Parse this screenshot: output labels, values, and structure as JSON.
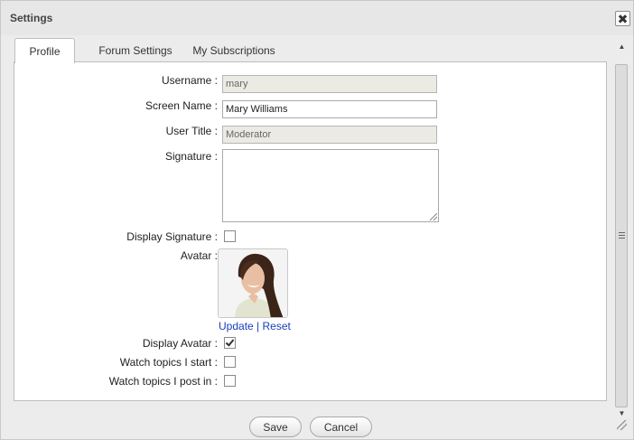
{
  "dialog": {
    "title": "Settings",
    "close_icon": "close-icon"
  },
  "tabs": [
    {
      "label": "Profile",
      "active": true
    },
    {
      "label": "Forum Settings",
      "active": false
    },
    {
      "label": "My Subscriptions",
      "active": false
    }
  ],
  "profile": {
    "username": {
      "label": "Username :",
      "value": "mary",
      "readonly": true
    },
    "screen_name": {
      "label": "Screen Name :",
      "value": "Mary Williams"
    },
    "user_title": {
      "label": "User Title :",
      "value": "Moderator",
      "readonly": true
    },
    "signature": {
      "label": "Signature :",
      "value": ""
    },
    "display_signature": {
      "label": "Display Signature :",
      "checked": false
    },
    "avatar": {
      "label": "Avatar :",
      "update_link": "Update",
      "separator": "|",
      "reset_link": "Reset"
    },
    "display_avatar": {
      "label": "Display Avatar :",
      "checked": true
    },
    "watch_start": {
      "label": "Watch topics I start :",
      "checked": false
    },
    "watch_post": {
      "label": "Watch topics I post in :",
      "checked": false
    }
  },
  "footer": {
    "save_label": "Save",
    "cancel_label": "Cancel"
  },
  "colors": {
    "link": "#1a3eb8",
    "readonly_bg": "#ebebe4",
    "dialog_bg": "#ececec"
  }
}
